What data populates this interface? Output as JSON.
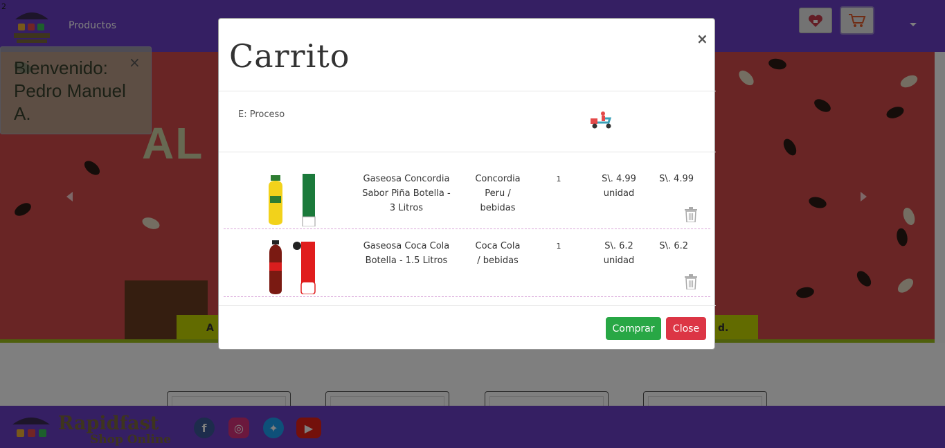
{
  "corner_number": "2",
  "nav": {
    "products_label": "Productos"
  },
  "welcome": {
    "text": "Bienvenido: Pedro Manuel A.",
    "close": "×"
  },
  "banner": {
    "word": "AL",
    "ribbon_left": "A",
    "ribbon_right": "d."
  },
  "modal": {
    "title": "Carrito",
    "close": "×",
    "status": "E: Proceso",
    "items": [
      {
        "name": "Gaseosa Concordia Sabor Piña Botella - 3 Litros",
        "brand": "Concordia Peru / bebidas",
        "qty": "1",
        "unit_price": "S\\. 4.99 unidad",
        "total": "S\\. 4.99",
        "image": "concordia-pina-bottle"
      },
      {
        "name": "Gaseosa Coca Cola Botella - 1.5 Litros",
        "brand": "Coca Cola / bebidas",
        "qty": "1",
        "unit_price": "S\\. 6.2 unidad",
        "total": "S\\. 6.2",
        "image": "coca-cola-bottle"
      }
    ],
    "buy_label": "Comprar",
    "close_label": "Close"
  },
  "footer": {
    "brand": "Rapidfast",
    "sub": "Shop Online",
    "social": [
      "facebook-icon",
      "instagram-icon",
      "twitter-icon",
      "youtube-icon"
    ]
  },
  "colors": {
    "brand_purple": "#6a3ec7",
    "buy_green": "#28a745",
    "close_red": "#dc3545"
  }
}
